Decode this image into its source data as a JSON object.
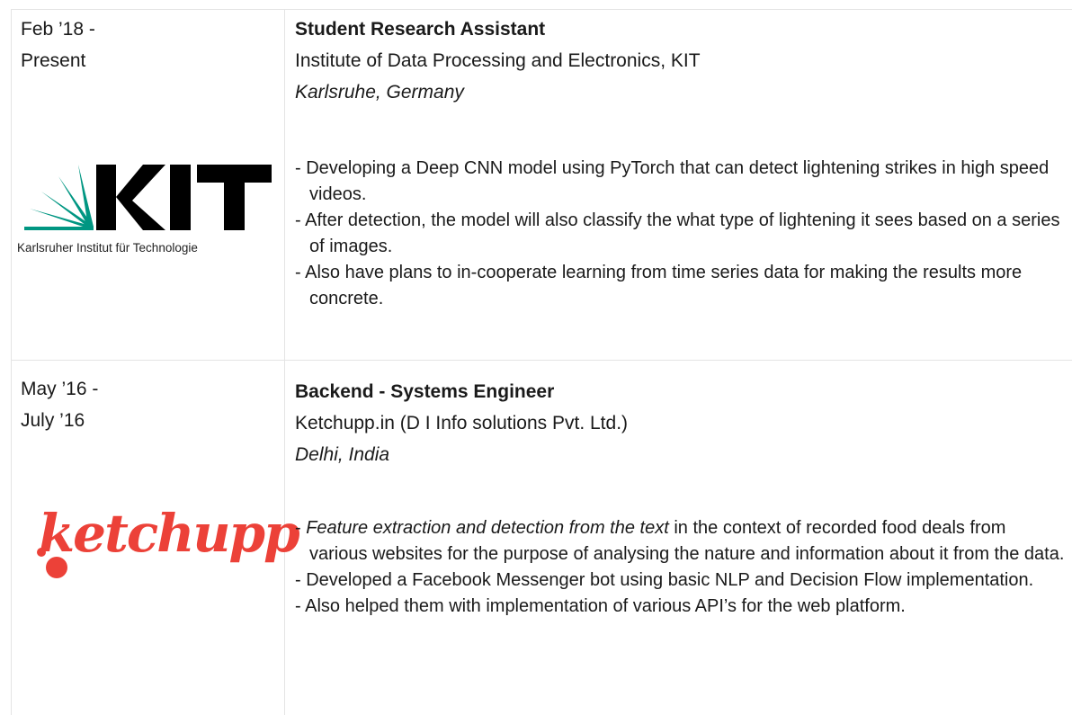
{
  "entries": [
    {
      "date": "Feb ’18 -\nPresent",
      "title": "Student Research Assistant",
      "organization": "Institute of Data Processing and Electronics, KIT",
      "location": "Karlsruhe, Germany",
      "logo": {
        "name": "kit-logo",
        "caption": "Karlsruher Institut für Technologie",
        "text": "KIT",
        "color": "#009682"
      },
      "points": [
        "- Developing a Deep CNN model using PyTorch that can detect lightening strikes in high speed videos.",
        "- After detection, the model will also classify the what type of lightening it sees based on a series of images.",
        "- Also have plans to in-cooperate learning from time series data for making the results more concrete."
      ]
    },
    {
      "date": "May ’16 -\nJuly ’16",
      "title": "Backend - Systems Engineer",
      "organization": "Ketchupp.in (D I Info solutions Pvt. Ltd.)",
      "location": "Delhi, India",
      "logo": {
        "name": "ketchupp-logo",
        "text": "ketchupp",
        "color": "#ec4138"
      },
      "points_first_emphasis": "Feature extraction and detection from the text",
      "points_first_rest": " in the context of recorded food deals from various websites for the purpose of analysing the nature and information about it from the data.",
      "points": [
        "- Developed a Facebook Messenger bot using basic NLP and Decision Flow implementation.",
        "- Also helped them with implementation of various API’s for the web platform."
      ]
    }
  ]
}
